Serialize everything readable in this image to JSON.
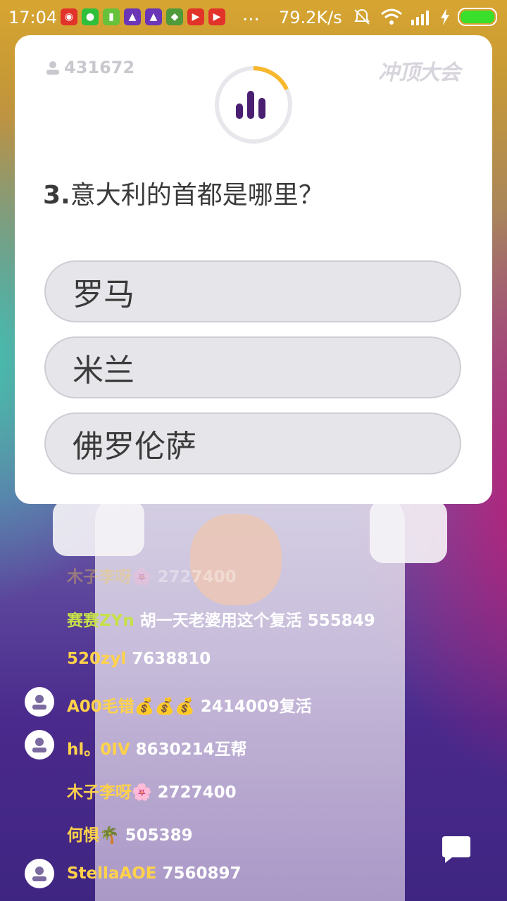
{
  "status_bar": {
    "time": "17:04",
    "net_speed": "79.2K/s",
    "more": "...",
    "icons": [
      "weibo-icon",
      "wechat-icon",
      "sim-icon",
      "app-icon",
      "app-icon",
      "android-icon",
      "video-icon",
      "video-icon"
    ]
  },
  "quiz": {
    "viewer_count": "431672",
    "brand": "冲顶大会",
    "question_number": "3.",
    "question_text": "意大利的首都是哪里？",
    "options": [
      {
        "label": "罗马"
      },
      {
        "label": "米兰"
      },
      {
        "label": "佛罗伦萨"
      }
    ],
    "timer_progress": 0.18,
    "accent_color": "#f8b82e"
  },
  "comments": [
    {
      "user": "木子李呀",
      "emoji": "🌸",
      "text": " 2727400",
      "avatar": false,
      "faded": true
    },
    {
      "user": "赛赛ZYn",
      "emoji": "",
      "text": " 胡一天老婆用这个复活 555849",
      "avatar": false,
      "faded": false,
      "green": true
    },
    {
      "user": "520zyl",
      "emoji": "",
      "text": " 7638810",
      "avatar": false,
      "faded": false
    },
    {
      "user": "A00毛错",
      "emoji": "💰💰💰",
      "text": " 2414009复活",
      "avatar": true,
      "faded": false
    },
    {
      "user": "hl。0IV",
      "emoji": "",
      "text": " 8630214互帮",
      "avatar": true,
      "faded": false
    },
    {
      "user": "木子李呀",
      "emoji": "🌸",
      "text": " 2727400",
      "avatar": false,
      "faded": false
    },
    {
      "user": "何惧",
      "emoji": "🌴",
      "text": " 505389",
      "avatar": false,
      "faded": false
    },
    {
      "user": "StellaAOE",
      "emoji": "",
      "text": " 7560897",
      "avatar": true,
      "faded": false
    }
  ]
}
